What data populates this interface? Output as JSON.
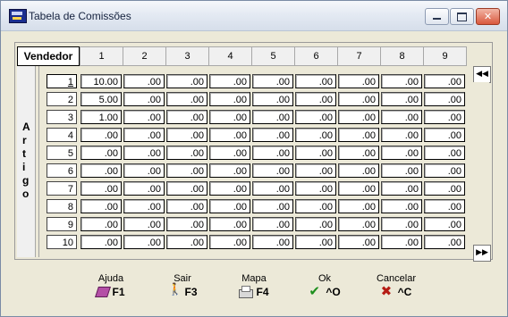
{
  "window": {
    "title": "Tabela de Comissões"
  },
  "grid": {
    "corner_label": "Vendedor",
    "row_axis_label": [
      "A",
      "r",
      "t",
      "i",
      "g",
      "o"
    ],
    "columns": [
      "1",
      "2",
      "3",
      "4",
      "5",
      "6",
      "7",
      "8",
      "9"
    ],
    "rows": [
      {
        "num": "1",
        "values": [
          "10.00",
          ".00",
          ".00",
          ".00",
          ".00",
          ".00",
          ".00",
          ".00",
          ".00"
        ]
      },
      {
        "num": "2",
        "values": [
          "5.00",
          ".00",
          ".00",
          ".00",
          ".00",
          ".00",
          ".00",
          ".00",
          ".00"
        ]
      },
      {
        "num": "3",
        "values": [
          "1.00",
          ".00",
          ".00",
          ".00",
          ".00",
          ".00",
          ".00",
          ".00",
          ".00"
        ]
      },
      {
        "num": "4",
        "values": [
          ".00",
          ".00",
          ".00",
          ".00",
          ".00",
          ".00",
          ".00",
          ".00",
          ".00"
        ]
      },
      {
        "num": "5",
        "values": [
          ".00",
          ".00",
          ".00",
          ".00",
          ".00",
          ".00",
          ".00",
          ".00",
          ".00"
        ]
      },
      {
        "num": "6",
        "values": [
          ".00",
          ".00",
          ".00",
          ".00",
          ".00",
          ".00",
          ".00",
          ".00",
          ".00"
        ]
      },
      {
        "num": "7",
        "values": [
          ".00",
          ".00",
          ".00",
          ".00",
          ".00",
          ".00",
          ".00",
          ".00",
          ".00"
        ]
      },
      {
        "num": "8",
        "values": [
          ".00",
          ".00",
          ".00",
          ".00",
          ".00",
          ".00",
          ".00",
          ".00",
          ".00"
        ]
      },
      {
        "num": "9",
        "values": [
          ".00",
          ".00",
          ".00",
          ".00",
          ".00",
          ".00",
          ".00",
          ".00",
          ".00"
        ]
      },
      {
        "num": "10",
        "values": [
          ".00",
          ".00",
          ".00",
          ".00",
          ".00",
          ".00",
          ".00",
          ".00",
          ".00"
        ]
      }
    ],
    "scroll_left_icon": "double-left-arrow-icon",
    "scroll_right_icon": "double-right-arrow-icon"
  },
  "footer": {
    "buttons": [
      {
        "label": "Ajuda",
        "key": "F1",
        "icon": "book-icon"
      },
      {
        "label": "Sair",
        "key": "F3",
        "icon": "exit-icon"
      },
      {
        "label": "Mapa",
        "key": "F4",
        "icon": "printer-icon"
      },
      {
        "label": "Ok",
        "key": "^O",
        "icon": "checkmark-icon"
      },
      {
        "label": "Cancelar",
        "key": "^C",
        "icon": "cancel-x-icon"
      }
    ]
  }
}
